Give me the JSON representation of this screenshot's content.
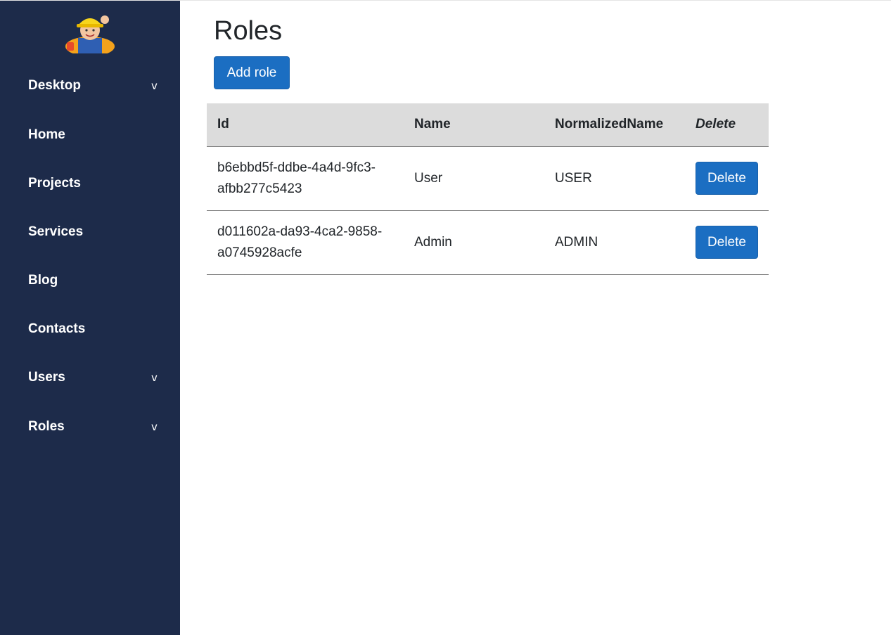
{
  "sidebar": {
    "items": [
      {
        "label": "Desktop",
        "chevron": "v"
      },
      {
        "label": "Home"
      },
      {
        "label": "Projects"
      },
      {
        "label": "Services"
      },
      {
        "label": "Blog"
      },
      {
        "label": "Contacts"
      },
      {
        "label": "Users",
        "chevron": "v"
      },
      {
        "label": "Roles",
        "chevron": "v"
      }
    ]
  },
  "main": {
    "title": "Roles",
    "add_label": "Add role",
    "table": {
      "headers": [
        "Id",
        "Name",
        "NormalizedName",
        "Delete"
      ],
      "rows": [
        {
          "id": "b6ebbd5f-ddbe-4a4d-9fc3-afbb277c5423",
          "name": "User",
          "normalized": "USER",
          "delete_label": "Delete"
        },
        {
          "id": "d011602a-da93-4ca2-9858-a0745928acfe",
          "name": "Admin",
          "normalized": "ADMIN",
          "delete_label": "Delete"
        }
      ]
    }
  },
  "colors": {
    "sidebar_bg": "#1d2b4a",
    "primary": "#1b6ec2",
    "table_header_bg": "#dcdcdc"
  }
}
